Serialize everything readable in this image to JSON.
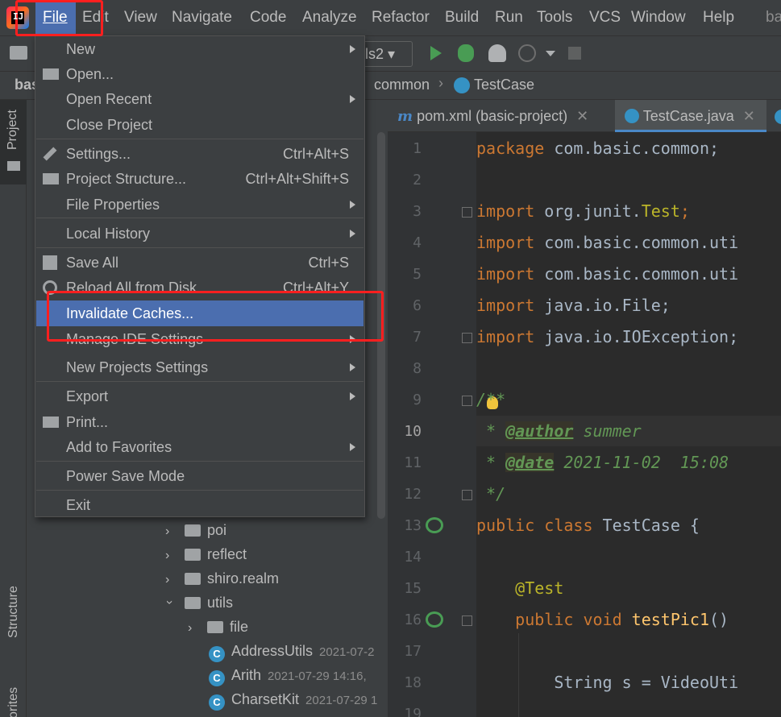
{
  "menubar": {
    "items": [
      "File",
      "Edit",
      "View",
      "Navigate",
      "Code",
      "Analyze",
      "Refactor",
      "Build",
      "Run",
      "Tools",
      "VCS",
      "Window",
      "Help"
    ],
    "title_fragment": "ba"
  },
  "toolbar": {
    "run_config_fragment": "ls2"
  },
  "navbar": {
    "crumb_left": "bas",
    "crumb_common": "common",
    "crumb_testcase": "TestCase"
  },
  "tool_windows": {
    "project": "Project",
    "structure": "Structure",
    "favorites_fragment": "orites"
  },
  "tabs": [
    {
      "label": "pom.xml (basic-project)"
    },
    {
      "label": "TestCase.java"
    }
  ],
  "file_menu": {
    "items": [
      {
        "label": "New",
        "submenu": true
      },
      {
        "label": "Open..."
      },
      {
        "label": "Open Recent",
        "submenu": true
      },
      {
        "label": "Close Project"
      },
      {
        "label": "Settings...",
        "shortcut": "Ctrl+Alt+S"
      },
      {
        "label": "Project Structure...",
        "shortcut": "Ctrl+Alt+Shift+S"
      },
      {
        "label": "File Properties",
        "submenu": true
      },
      {
        "label": "Local History",
        "submenu": true
      },
      {
        "label": "Save All",
        "shortcut": "Ctrl+S"
      },
      {
        "label": "Reload All from Disk",
        "shortcut": "Ctrl+Alt+Y"
      },
      {
        "label": "Invalidate Caches...",
        "selected": true
      },
      {
        "label": "Manage IDE Settings",
        "submenu": true
      },
      {
        "label": "New Projects Settings",
        "submenu": true
      },
      {
        "label": "Export",
        "submenu": true
      },
      {
        "label": "Print..."
      },
      {
        "label": "Add to Favorites",
        "submenu": true
      },
      {
        "label": "Power Save Mode"
      },
      {
        "label": "Exit"
      }
    ]
  },
  "project_tree": [
    {
      "label": "poi",
      "type": "folder",
      "expanded": false
    },
    {
      "label": "reflect",
      "type": "folder",
      "expanded": false
    },
    {
      "label": "shiro.realm",
      "type": "folder",
      "expanded": false
    },
    {
      "label": "utils",
      "type": "folder",
      "expanded": true
    },
    {
      "label": "file",
      "type": "folder",
      "expanded": false
    },
    {
      "label": "AddressUtils",
      "type": "class",
      "meta": "2021-07-2"
    },
    {
      "label": "Arith",
      "type": "class",
      "meta": "2021-07-29 14:16,"
    },
    {
      "label": "CharsetKit",
      "type": "class",
      "meta": "2021-07-29 1"
    }
  ],
  "editor": {
    "line_numbers": [
      "1",
      "2",
      "3",
      "4",
      "5",
      "6",
      "7",
      "8",
      "9",
      "10",
      "11",
      "12",
      "13",
      "14",
      "15",
      "16",
      "17",
      "18",
      "19"
    ],
    "lines": {
      "l1a": "package",
      "l1b": " com.basic.common;",
      "l3a": "import",
      "l3b": " org.junit.",
      "l3c": "Test",
      "l3d": ";",
      "l4a": "import",
      "l4b": " com.basic.common.uti",
      "l5a": "import",
      "l5b": " com.basic.common.uti",
      "l6a": "import",
      "l6b": " java.io.File;",
      "l7a": "import",
      "l7b": " java.io.IOException;",
      "l9": "/**",
      "l10a": " * ",
      "l10b": "@author",
      "l10c": " summer",
      "l11a": " * ",
      "l11b": "@date",
      "l11c": " 2021-11-02  15:08",
      "l12": " */",
      "l13a": "public class",
      "l13b": " TestCase {",
      "l15": "    @Test",
      "l16a": "    public void",
      "l16b": " testPic1",
      "l16c": "()",
      "l18": "        String s = VideoUti"
    }
  },
  "colors": {
    "menu_selection": "#4b6eaf",
    "highlight_box": "#ff1f1f"
  }
}
